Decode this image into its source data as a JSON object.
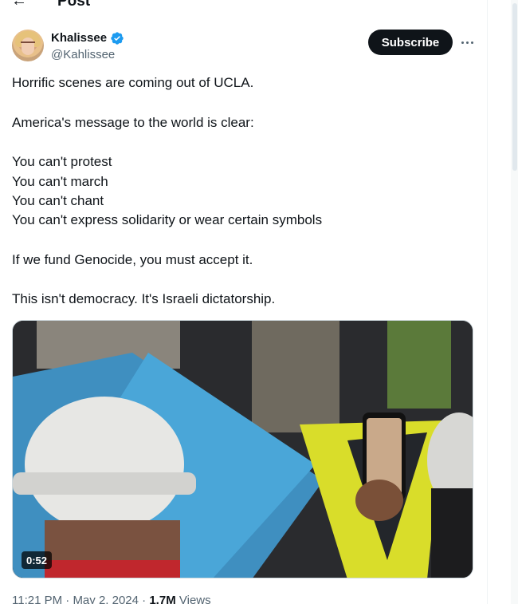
{
  "header": {
    "title": "Post",
    "back_icon": "arrow-left-icon"
  },
  "author": {
    "name": "Khalissee",
    "handle": "@Kahlissee",
    "verified": true,
    "verified_color": "#1d9bf0"
  },
  "actions": {
    "subscribe_label": "Subscribe",
    "more_icon": "more-horizontal-icon"
  },
  "tweet": {
    "lines": [
      "Horrific scenes are coming out of UCLA.",
      "America's message to the world is clear:",
      "You can't protest",
      "You can't march",
      "You can't chant",
      "You can't express solidarity or wear certain symbols",
      "If we fund Genocide, you must accept it.",
      "This isn't democracy. It's Israeli dictatorship."
    ]
  },
  "media": {
    "type": "video",
    "duration": "0:52"
  },
  "meta": {
    "time": "11:21 PM",
    "date": "May 2, 2024",
    "separator": "·",
    "views_count": "1.7M",
    "views_label": "Views"
  }
}
